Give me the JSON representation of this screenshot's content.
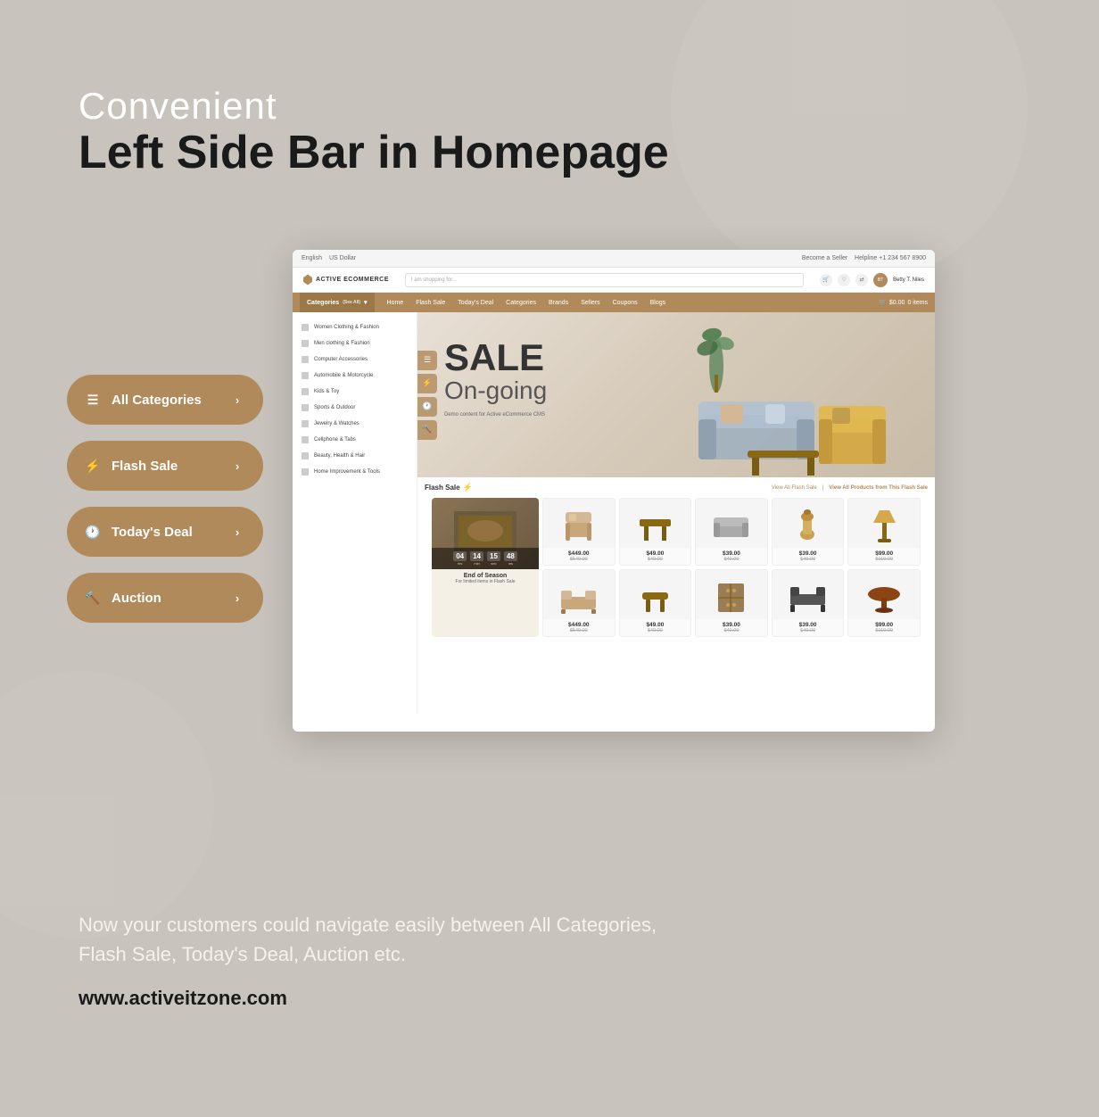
{
  "background": "#c8c3bc",
  "header": {
    "convenient": "Convenient",
    "main_title": "Left Side Bar in Homepage"
  },
  "sidebar_buttons": [
    {
      "id": "all-categories",
      "label": "All Categories",
      "icon": "☰"
    },
    {
      "id": "flash-sale",
      "label": "Flash Sale",
      "icon": "⚡"
    },
    {
      "id": "todays-deal",
      "label": "Today's Deal",
      "icon": "🕐"
    },
    {
      "id": "auction",
      "label": "Auction",
      "icon": "🔨"
    }
  ],
  "browser": {
    "topbar": {
      "lang": "English",
      "currency": "US Dollar",
      "helpline": "Helpline +1 234 567 8900",
      "seller_text": "Become a Seller"
    },
    "nav": {
      "logo_text": "ACTIVE ECOMMERCE",
      "search_placeholder": "I am shopping for...",
      "user_name": "Betty T. Niles"
    },
    "menu_items": [
      "Categories",
      "Home",
      "Flash Sale",
      "Today's Deal",
      "Categories",
      "Brands",
      "Sellers",
      "Coupons",
      "Blogs"
    ],
    "cart_text": "$0.00",
    "cart_items": "0 items",
    "categories": [
      "Women Clothing & Fashion",
      "Men clothing & Fashion",
      "Computer Accessories",
      "Automobile & Motorcycle",
      "Kids & Toy",
      "Sports & Outdoor",
      "Jewelry & Watches",
      "Cellphone & Tabs",
      "Beauty, Health & Hair",
      "Home Improvement & Tools"
    ],
    "banner": {
      "sale_text": "SALE",
      "ongoing_text": "On-going",
      "demo_text": "Demo content for Active eCommerce CMS"
    },
    "flash_sale": {
      "title": "Flash Sale",
      "view_all": "View All Flash Sale",
      "view_products": "View All Products from This Flash Sale",
      "timer": {
        "hours": "04",
        "minutes": "14",
        "seconds": "15",
        "milliseconds": "48"
      },
      "card_title": "End of Season",
      "card_sub": "For limited items in Flash Sale"
    },
    "products": [
      {
        "price": "$449.00",
        "original": "$549.00",
        "type": "chair"
      },
      {
        "price": "$49.00",
        "original": "$49.00",
        "type": "table"
      },
      {
        "price": "$39.00",
        "original": "$49.00",
        "type": "sofa"
      },
      {
        "price": "$39.00",
        "original": "$49.00",
        "type": "vase"
      },
      {
        "price": "$99.00",
        "original": "$119.00",
        "type": "lamp"
      },
      {
        "price": "$449.00",
        "original": "$549.00",
        "type": "bed"
      },
      {
        "price": "$49.00",
        "original": "$49.00",
        "type": "stool"
      },
      {
        "price": "$39.00",
        "original": "$49.00",
        "type": "cabinet"
      },
      {
        "price": "$39.00",
        "original": "$49.00",
        "type": "bedframe"
      },
      {
        "price": "$99.00",
        "original": "$119.00",
        "type": "roundtable"
      }
    ]
  },
  "bottom": {
    "description": "Now your customers could navigate easily between All Categories,\nFlash Sale, Today's Deal, Auction etc.",
    "url": "www.activeitzone.com"
  },
  "colors": {
    "gold_brown": "#b08a5a",
    "dark": "#1a1a1a",
    "white": "#ffffff"
  }
}
